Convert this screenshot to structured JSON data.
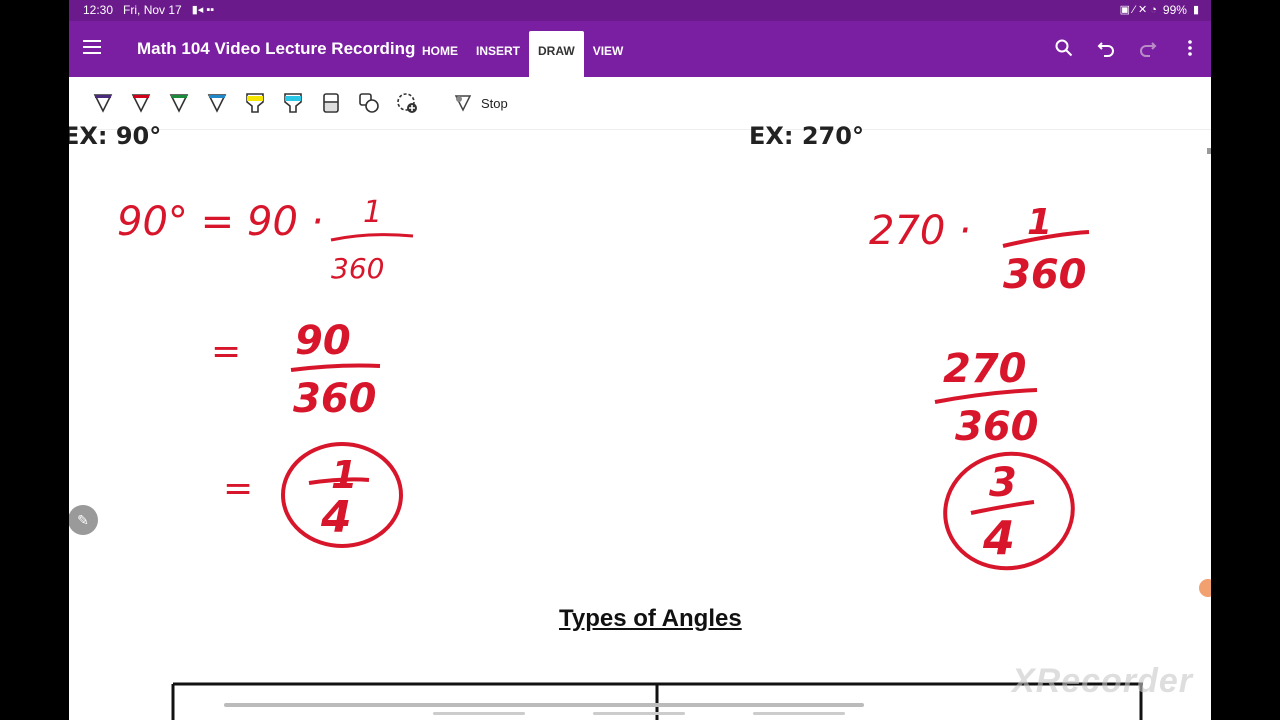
{
  "status_bar": {
    "time": "12:30",
    "date": "Fri, Nov 17",
    "battery": "99%"
  },
  "app_bar": {
    "title": "Math 104 Video Lecture Recording",
    "tabs": [
      {
        "label": "HOME",
        "active": false
      },
      {
        "label": "INSERT",
        "active": false
      },
      {
        "label": "DRAW",
        "active": true
      },
      {
        "label": "VIEW",
        "active": false
      }
    ],
    "actions": [
      "search-icon",
      "undo-icon",
      "redo-icon",
      "more-icon"
    ],
    "color": "#7b1fa2"
  },
  "toolbar": {
    "pens": [
      {
        "name": "pen-purple",
        "color": "#4a2a7a"
      },
      {
        "name": "pen-red",
        "color": "#d0021b"
      },
      {
        "name": "pen-green",
        "color": "#1b8a3a"
      },
      {
        "name": "pen-blue",
        "color": "#1e88c8"
      },
      {
        "name": "highlighter-yellow",
        "color": "#f5e600"
      },
      {
        "name": "highlighter-cyan",
        "color": "#29c6e6"
      }
    ],
    "tools": [
      "eraser-icon",
      "shapes-icon",
      "add-pen-icon"
    ],
    "stop_label": "Stop"
  },
  "page": {
    "left_example": "EX:  90°",
    "right_example": "EX:  270°",
    "heading": "Types of Angles",
    "watermark": "XRecorder",
    "handwriting": {
      "left": {
        "line1_lhs": "90° =",
        "line1_rhs": "90 ·",
        "frac1_num": "1",
        "frac1_den": "360",
        "eq2": "=",
        "frac2_num": "90",
        "frac2_den": "360",
        "eq3": "=",
        "result_num": "1",
        "result_den": "4"
      },
      "right": {
        "line1": "270 ·",
        "frac1_num": "1",
        "frac1_den": "360",
        "frac2_num": "270",
        "frac2_den": "360",
        "result_num": "3",
        "result_den": "4"
      },
      "ink_color": "#d8162b"
    }
  }
}
